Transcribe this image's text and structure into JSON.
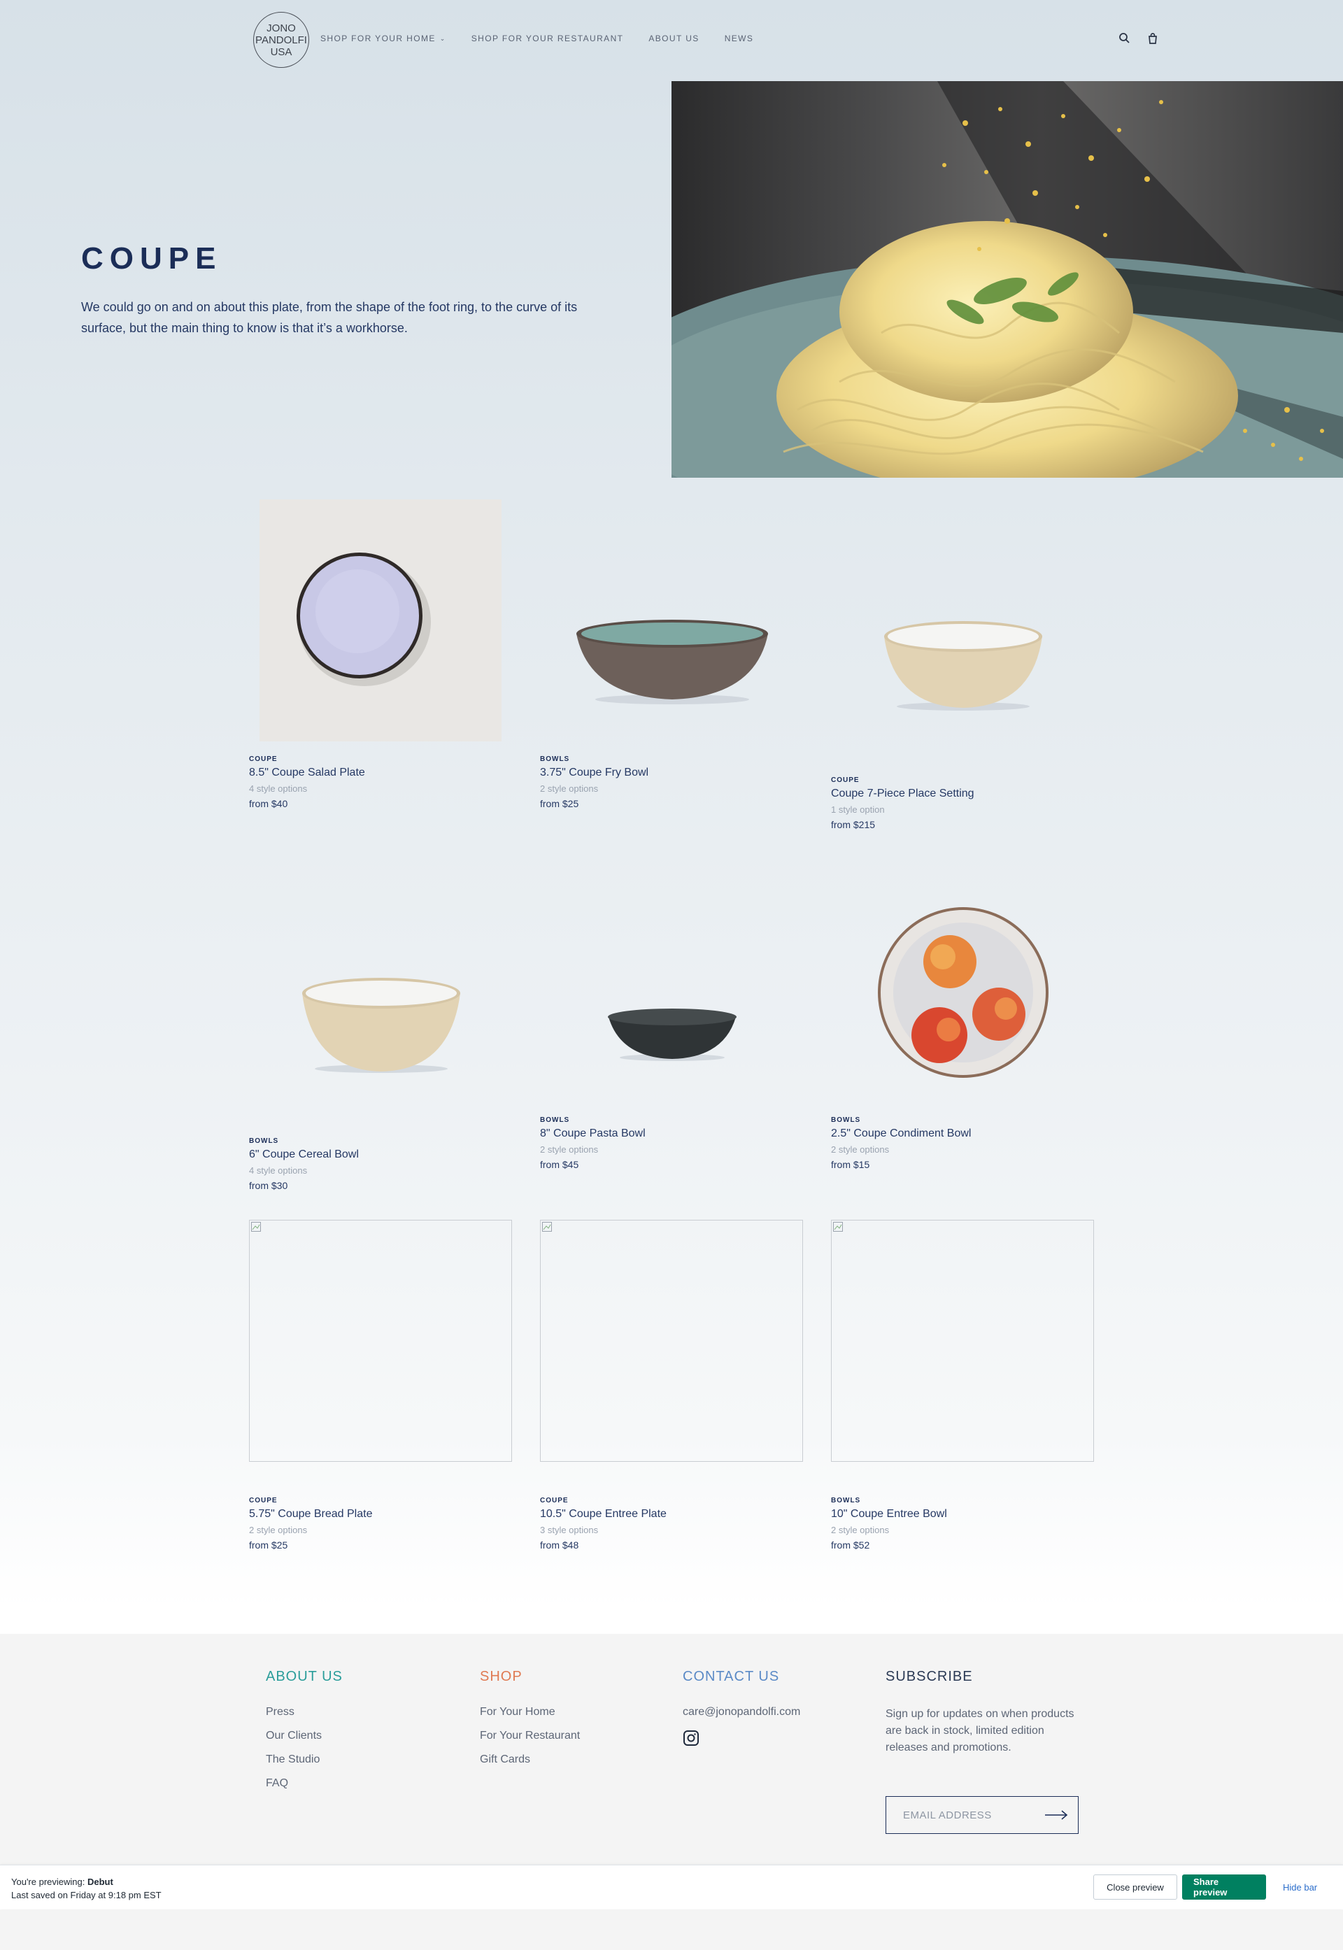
{
  "header": {
    "logo_lines": [
      "JONO",
      "PANDOLFI",
      "USA"
    ],
    "nav": [
      {
        "label": "SHOP FOR YOUR HOME",
        "has_dropdown": true
      },
      {
        "label": "SHOP FOR YOUR RESTAURANT",
        "has_dropdown": false
      },
      {
        "label": "ABOUT US",
        "has_dropdown": false
      },
      {
        "label": "NEWS",
        "has_dropdown": false
      }
    ],
    "icons": [
      "search-icon",
      "cart-icon"
    ]
  },
  "hero": {
    "title": "COUPE",
    "description": "We could go on and on about this plate, from the shape of the foot ring, to the curve of its surface, but the main thing to know is that it’s a workhorse."
  },
  "products": [
    {
      "category": "COUPE",
      "name": "8.5\" Coupe Salad Plate",
      "options": "4 style options",
      "price": "from $40"
    },
    {
      "category": "BOWLS",
      "name": "3.75\" Coupe Fry Bowl",
      "options": "2 style options",
      "price": "from $25"
    },
    {
      "category": "COUPE",
      "name": "Coupe 7-Piece Place Setting",
      "options": "1 style option",
      "price": "from $215"
    },
    {
      "category": "BOWLS",
      "name": "6\" Coupe Cereal Bowl",
      "options": "4 style options",
      "price": "from $30"
    },
    {
      "category": "BOWLS",
      "name": "8\" Coupe Pasta Bowl",
      "options": "2 style options",
      "price": "from $45"
    },
    {
      "category": "BOWLS",
      "name": "2.5\" Coupe Condiment Bowl",
      "options": "2 style options",
      "price": "from $15"
    },
    {
      "category": "COUPE",
      "name": "5.75\" Coupe Bread Plate",
      "options": "2 style options",
      "price": "from $25"
    },
    {
      "category": "COUPE",
      "name": "10.5\" Coupe Entree Plate",
      "options": "3 style options",
      "price": "from $48"
    },
    {
      "category": "BOWLS",
      "name": "10\" Coupe Entree Bowl",
      "options": "2 style options",
      "price": "from $52"
    }
  ],
  "footer": {
    "about": {
      "heading": "ABOUT US",
      "links": [
        "Press",
        "Our Clients",
        "The Studio",
        "FAQ"
      ],
      "color": "#2a9d9a"
    },
    "shop": {
      "heading": "SHOP",
      "links": [
        "For Your Home",
        "For Your Restaurant",
        "Gift Cards"
      ],
      "color": "#e07a52"
    },
    "contact": {
      "heading": "CONTACT US",
      "email": "care@jonopandolfi.com",
      "color": "#5b8ac6"
    },
    "subscribe": {
      "heading": "SUBSCRIBE",
      "description": "Sign up for updates on when products are back in stock, limited edition releases and promotions.",
      "placeholder": "EMAIL ADDRESS",
      "color": "#2b3a55"
    }
  },
  "preview_bar": {
    "previewing_prefix": "You're previewing:",
    "theme": "Debut",
    "last_saved": "Last saved on Friday at 9:18 pm EST",
    "close_label": "Close preview",
    "share_label": "Share preview",
    "hide_label": "Hide bar"
  }
}
